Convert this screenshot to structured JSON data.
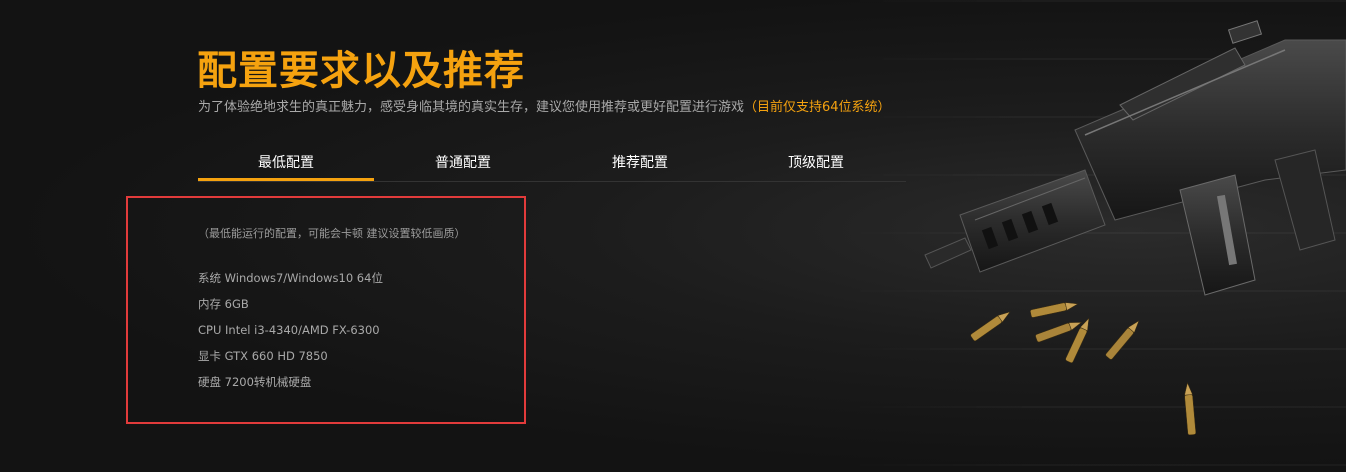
{
  "header": {
    "title": "配置要求以及推荐",
    "subtitle": "为了体验绝地求生的真正魅力，感受身临其境的真实生存，建议您使用推荐或更好配置进行游戏",
    "subtitle_highlight": "（目前仅支持64位系统）"
  },
  "tabs": [
    {
      "label": "最低配置",
      "active": true
    },
    {
      "label": "普通配置",
      "active": false
    },
    {
      "label": "推荐配置",
      "active": false
    },
    {
      "label": "顶级配置",
      "active": false
    }
  ],
  "spec": {
    "note": "（最低能运行的配置，可能会卡顿 建议设置较低画质）",
    "rows": [
      "系统 Windows7/Windows10 64位",
      "内存 6GB",
      "CPU Intel i3-4340/AMD FX-6300",
      "显卡 GTX 660 HD 7850",
      "硬盘 7200转机械硬盘"
    ]
  },
  "colors": {
    "accent": "#f5a20f",
    "background": "#151515",
    "highlight_box": "#e23b3b",
    "body_text": "#a9a9a9"
  },
  "icons": {
    "decoration": "rifle-illustration",
    "decoration2": "bullets-illustration"
  }
}
